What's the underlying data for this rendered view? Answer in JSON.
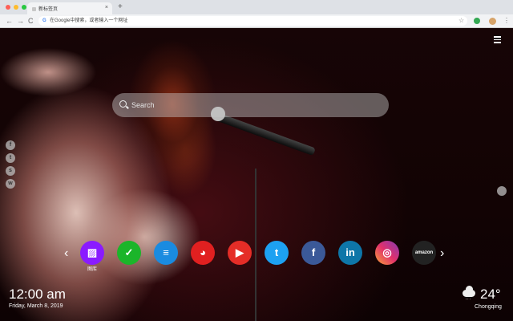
{
  "browser": {
    "tab_title": "新标签页",
    "tab_close": "×",
    "new_tab": "+",
    "back": "←",
    "forward": "→",
    "reload": "C",
    "google_g": "G",
    "address_placeholder": "在Google中搜索，或者输入一个网址",
    "star": "☆",
    "menu": "⋮",
    "traffic_lights": [
      "#fe5f57",
      "#febc2e",
      "#28c840"
    ]
  },
  "page": {
    "search_placeholder": "Search",
    "social_icons": [
      "facebook-icon",
      "twitter-icon",
      "snapchat-icon",
      "wechat-icon"
    ],
    "social_glyphs": [
      "f",
      "t",
      "s",
      "w"
    ],
    "prev_arrow": "‹",
    "next_arrow": "›",
    "speed_dial": [
      {
        "icon": "gallery-icon",
        "glyph": "▨",
        "label": "图库",
        "color": "#8a1bff"
      },
      {
        "icon": "check-icon",
        "glyph": "✓",
        "label": "",
        "color": "#1bb52a"
      },
      {
        "icon": "news-icon",
        "glyph": "≡",
        "label": "",
        "color": "#1a8be0"
      },
      {
        "icon": "game-icon",
        "glyph": "◕",
        "label": "",
        "color": "#e12020"
      },
      {
        "icon": "youtube-icon",
        "glyph": "▶",
        "label": "",
        "color": "#e52d27"
      },
      {
        "icon": "twitter-icon",
        "glyph": "t",
        "label": "",
        "color": "#1da1f2"
      },
      {
        "icon": "facebook-icon",
        "glyph": "f",
        "label": "",
        "color": "#3b5998"
      },
      {
        "icon": "linkedin-icon",
        "glyph": "in",
        "label": "",
        "color": "#0e76a8"
      },
      {
        "icon": "instagram-icon",
        "glyph": "◎",
        "label": "",
        "color": "#c13584"
      },
      {
        "icon": "amazon-icon",
        "glyph": "amazon",
        "label": "",
        "color": "#222222"
      }
    ],
    "clock": {
      "time": "12:00 am",
      "date": "Friday, March 8, 2019"
    },
    "weather": {
      "icon": "cloud-rain-icon",
      "temp": "24°",
      "city": "Chongqing"
    }
  }
}
